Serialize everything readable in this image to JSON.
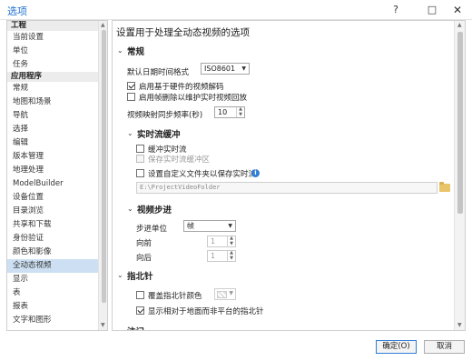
{
  "window": {
    "title": "选项",
    "help": "?",
    "maximize": "□",
    "close": "✕"
  },
  "sidebar": {
    "group_project": "工程",
    "project_items": [
      "当前设置",
      "单位",
      "任务"
    ],
    "group_app": "应用程序",
    "app_items": [
      "常规",
      "地图和场景",
      "导航",
      "选择",
      "编辑",
      "版本管理",
      "地理处理",
      "ModelBuilder",
      "设备位置",
      "目录浏览",
      "共享和下载",
      "身份验证",
      "颜色和影像",
      "全动态视频",
      "显示",
      "表",
      "报表",
      "文字和图形"
    ],
    "selected": "全动态视频"
  },
  "main": {
    "heading": "设置用于处理全动态视频的选项",
    "general": {
      "title": "常规",
      "date_format_label": "默认日期时间格式",
      "date_format_value": "ISO8601",
      "hw_decode_label": "启用基于硬件的视频解码",
      "hw_decode_checked": true,
      "remove_frames_label": "启用帧删除以维护实时视频回放",
      "remove_frames_checked": false,
      "sync_label": "视频映射同步频率(秒)",
      "sync_value": "10"
    },
    "realtime": {
      "title": "实时流缓冲",
      "buffer_label": "缓冲实时流",
      "buffer_checked": false,
      "save_buffer_label": "保存实时流缓冲区",
      "custom_folder_label": "设置自定义文件夹以保存实时流",
      "info": "i",
      "folder_path": "E:\\ProjectVideoFolder"
    },
    "step": {
      "title": "视频步进",
      "unit_label": "步进单位",
      "unit_value": "帧",
      "forward_label": "向前",
      "forward_value": "1",
      "backward_label": "向后",
      "backward_value": "1"
    },
    "compass": {
      "title": "指北针",
      "override_label": "覆盖指北针颜色",
      "override_checked": false,
      "show_label": "显示相对于地面而非平台的指北针",
      "show_checked": true
    },
    "next_section_partial": "注记"
  },
  "footer": {
    "ok": "确定(O)",
    "cancel": "取消"
  }
}
